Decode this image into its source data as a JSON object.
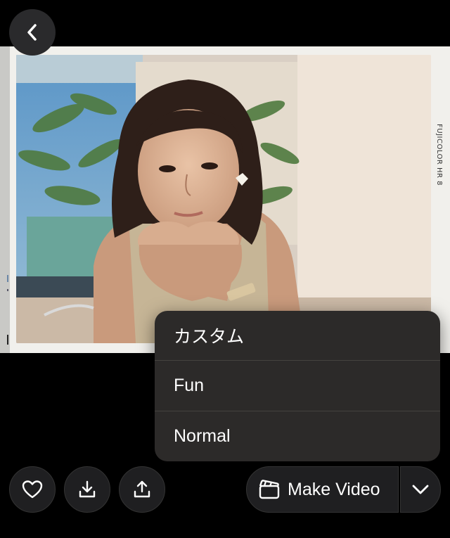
{
  "photo": {
    "film_label": "FUJICOLOR HR 8",
    "description_icon": "photo-image"
  },
  "menu": {
    "items": [
      {
        "label": "カスタム"
      },
      {
        "label": "Fun"
      },
      {
        "label": "Normal"
      }
    ]
  },
  "toolbar": {
    "make_video_label": "Make Video",
    "icons": {
      "back": "back-chevron-icon",
      "like": "heart-icon",
      "download": "download-icon",
      "share": "share-icon",
      "video": "clapperboard-icon",
      "expand": "chevron-down-icon"
    }
  },
  "colors": {
    "background": "#000000",
    "surface": "#1f1f21",
    "menu": "#2c2a29"
  }
}
